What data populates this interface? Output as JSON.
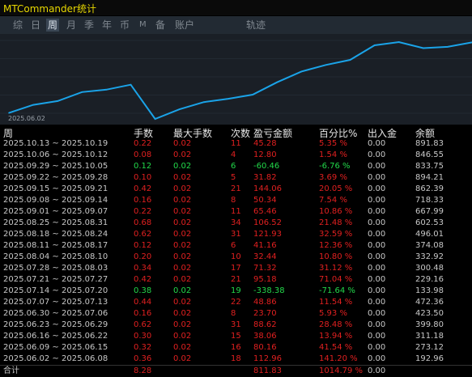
{
  "title": "MTCommander统计",
  "tabs": [
    {
      "label": "综",
      "active": false
    },
    {
      "label": "日",
      "active": false
    },
    {
      "label": "周",
      "active": true
    },
    {
      "label": "月",
      "active": false
    },
    {
      "label": "季",
      "active": false
    },
    {
      "label": "年",
      "active": false
    },
    {
      "label": "币",
      "active": false
    },
    {
      "label": "M",
      "active": false
    },
    {
      "label": "备",
      "active": false
    },
    {
      "label": "账户",
      "active": false
    },
    {
      "label": "轨迹",
      "active": false
    }
  ],
  "chart_data": {
    "type": "line",
    "x": [
      "2025.06.02",
      "2025.06.09",
      "2025.06.16",
      "2025.06.23",
      "2025.06.30",
      "2025.07.07",
      "2025.07.14",
      "2025.07.21",
      "2025.07.28",
      "2025.08.04",
      "2025.08.11",
      "2025.08.18",
      "2025.08.25",
      "2025.09.01",
      "2025.09.08",
      "2025.09.15",
      "2025.09.22",
      "2025.09.29",
      "2025.10.06",
      "2025.10.13"
    ],
    "series": [
      {
        "values": [
          192.96,
          273.12,
          311.18,
          399.8,
          423.5,
          472.36,
          133.98,
          229.16,
          300.48,
          332.92,
          374.08,
          496.01,
          602.53,
          667.99,
          718.33,
          862.39,
          894.21,
          833.75,
          846.55,
          891.83
        ]
      }
    ],
    "xlabel": "2025.06.02",
    "color": "#1aa3e8"
  },
  "table": {
    "headers": {
      "week": "周",
      "lots": "手数",
      "max_lots": "最大手数",
      "count": "次数",
      "pnl": "盈亏金额",
      "pct": "百分比%",
      "io": "出入金",
      "balance": "余额"
    },
    "rows": [
      {
        "week": "2025.10.13 ~ 2025.10.19",
        "lots": "0.22",
        "max": "0.02",
        "count": "11",
        "pnl": "45.28",
        "pct": "5.35 %",
        "io": "0.00",
        "bal": "891.83",
        "dir": "red"
      },
      {
        "week": "2025.10.06 ~ 2025.10.12",
        "lots": "0.08",
        "max": "0.02",
        "count": "4",
        "pnl": "12.80",
        "pct": "1.54 %",
        "io": "0.00",
        "bal": "846.55",
        "dir": "red"
      },
      {
        "week": "2025.09.29 ~ 2025.10.05",
        "lots": "0.12",
        "max": "0.02",
        "count": "6",
        "pnl": "-60.46",
        "pct": "-6.76 %",
        "io": "0.00",
        "bal": "833.75",
        "dir": "green"
      },
      {
        "week": "2025.09.22 ~ 2025.09.28",
        "lots": "0.10",
        "max": "0.02",
        "count": "5",
        "pnl": "31.82",
        "pct": "3.69 %",
        "io": "0.00",
        "bal": "894.21",
        "dir": "red"
      },
      {
        "week": "2025.09.15 ~ 2025.09.21",
        "lots": "0.42",
        "max": "0.02",
        "count": "21",
        "pnl": "144.06",
        "pct": "20.05 %",
        "io": "0.00",
        "bal": "862.39",
        "dir": "red"
      },
      {
        "week": "2025.09.08 ~ 2025.09.14",
        "lots": "0.16",
        "max": "0.02",
        "count": "8",
        "pnl": "50.34",
        "pct": "7.54 %",
        "io": "0.00",
        "bal": "718.33",
        "dir": "red"
      },
      {
        "week": "2025.09.01 ~ 2025.09.07",
        "lots": "0.22",
        "max": "0.02",
        "count": "11",
        "pnl": "65.46",
        "pct": "10.86 %",
        "io": "0.00",
        "bal": "667.99",
        "dir": "red"
      },
      {
        "week": "2025.08.25 ~ 2025.08.31",
        "lots": "0.68",
        "max": "0.02",
        "count": "34",
        "pnl": "106.52",
        "pct": "21.48 %",
        "io": "0.00",
        "bal": "602.53",
        "dir": "red"
      },
      {
        "week": "2025.08.18 ~ 2025.08.24",
        "lots": "0.62",
        "max": "0.02",
        "count": "31",
        "pnl": "121.93",
        "pct": "32.59 %",
        "io": "0.00",
        "bal": "496.01",
        "dir": "red"
      },
      {
        "week": "2025.08.11 ~ 2025.08.17",
        "lots": "0.12",
        "max": "0.02",
        "count": "6",
        "pnl": "41.16",
        "pct": "12.36 %",
        "io": "0.00",
        "bal": "374.08",
        "dir": "red"
      },
      {
        "week": "2025.08.04 ~ 2025.08.10",
        "lots": "0.20",
        "max": "0.02",
        "count": "10",
        "pnl": "32.44",
        "pct": "10.80 %",
        "io": "0.00",
        "bal": "332.92",
        "dir": "red"
      },
      {
        "week": "2025.07.28 ~ 2025.08.03",
        "lots": "0.34",
        "max": "0.02",
        "count": "17",
        "pnl": "71.32",
        "pct": "31.12 %",
        "io": "0.00",
        "bal": "300.48",
        "dir": "red"
      },
      {
        "week": "2025.07.21 ~ 2025.07.27",
        "lots": "0.42",
        "max": "0.02",
        "count": "21",
        "pnl": "95.18",
        "pct": "71.04 %",
        "io": "0.00",
        "bal": "229.16",
        "dir": "red"
      },
      {
        "week": "2025.07.14 ~ 2025.07.20",
        "lots": "0.38",
        "max": "0.02",
        "count": "19",
        "pnl": "-338.38",
        "pct": "-71.64 %",
        "io": "0.00",
        "bal": "133.98",
        "dir": "green"
      },
      {
        "week": "2025.07.07 ~ 2025.07.13",
        "lots": "0.44",
        "max": "0.02",
        "count": "22",
        "pnl": "48.86",
        "pct": "11.54 %",
        "io": "0.00",
        "bal": "472.36",
        "dir": "red"
      },
      {
        "week": "2025.06.30 ~ 2025.07.06",
        "lots": "0.16",
        "max": "0.02",
        "count": "8",
        "pnl": "23.70",
        "pct": "5.93 %",
        "io": "0.00",
        "bal": "423.50",
        "dir": "red"
      },
      {
        "week": "2025.06.23 ~ 2025.06.29",
        "lots": "0.62",
        "max": "0.02",
        "count": "31",
        "pnl": "88.62",
        "pct": "28.48 %",
        "io": "0.00",
        "bal": "399.80",
        "dir": "red"
      },
      {
        "week": "2025.06.16 ~ 2025.06.22",
        "lots": "0.30",
        "max": "0.02",
        "count": "15",
        "pnl": "38.06",
        "pct": "13.94 %",
        "io": "0.00",
        "bal": "311.18",
        "dir": "red"
      },
      {
        "week": "2025.06.09 ~ 2025.06.15",
        "lots": "0.32",
        "max": "0.02",
        "count": "16",
        "pnl": "80.16",
        "pct": "41.54 %",
        "io": "0.00",
        "bal": "273.12",
        "dir": "red"
      },
      {
        "week": "2025.06.02 ~ 2025.06.08",
        "lots": "0.36",
        "max": "0.02",
        "count": "18",
        "pnl": "112.96",
        "pct": "141.20 %",
        "io": "0.00",
        "bal": "192.96",
        "dir": "red"
      }
    ],
    "total": {
      "label": "合计",
      "lots": "8.28",
      "pnl": "811.83",
      "pct": "1014.79 %",
      "io": "0.00"
    }
  }
}
